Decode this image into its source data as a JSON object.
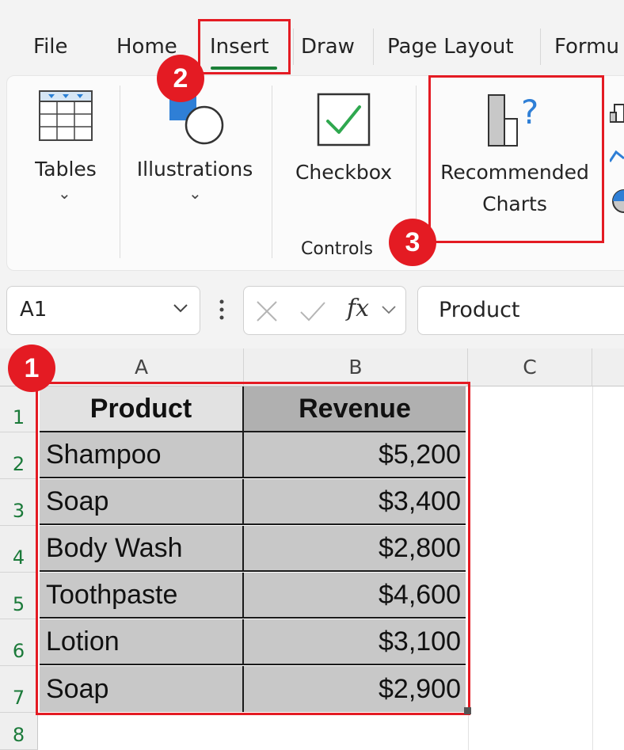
{
  "menu": {
    "tabs": [
      "File",
      "Home",
      "Insert",
      "Draw",
      "Page Layout",
      "Formu"
    ],
    "active": "Insert"
  },
  "ribbon": {
    "tables_label": "Tables",
    "illustrations_label": "Illustrations",
    "checkbox_label": "Checkbox",
    "controls_group_label": "Controls",
    "recommended_line1": "Recommended",
    "recommended_line2": "Charts",
    "chevron": "⌄"
  },
  "formula_bar": {
    "name_box": "A1",
    "fx": "fx",
    "content": "Product"
  },
  "grid": {
    "columns": [
      "A",
      "B",
      "C"
    ],
    "row_numbers": [
      "1",
      "2",
      "3",
      "4",
      "5",
      "6",
      "7",
      "8"
    ],
    "headers": [
      "Product",
      "Revenue"
    ],
    "rows": [
      [
        "Shampoo",
        "$5,200"
      ],
      [
        "Soap",
        "$3,400"
      ],
      [
        "Body Wash",
        "$2,800"
      ],
      [
        "Toothpaste",
        "$4,600"
      ],
      [
        "Lotion",
        "$3,100"
      ],
      [
        "Soap",
        "$2,900"
      ]
    ]
  },
  "steps": [
    "1",
    "2",
    "3"
  ],
  "colors": {
    "highlight_red": "#e41b23",
    "accent_green": "#1a7f37",
    "cell_gray": "#c8c8c8",
    "header_gray_a": "#e2e2e2",
    "header_gray_b": "#b0b0b0"
  }
}
